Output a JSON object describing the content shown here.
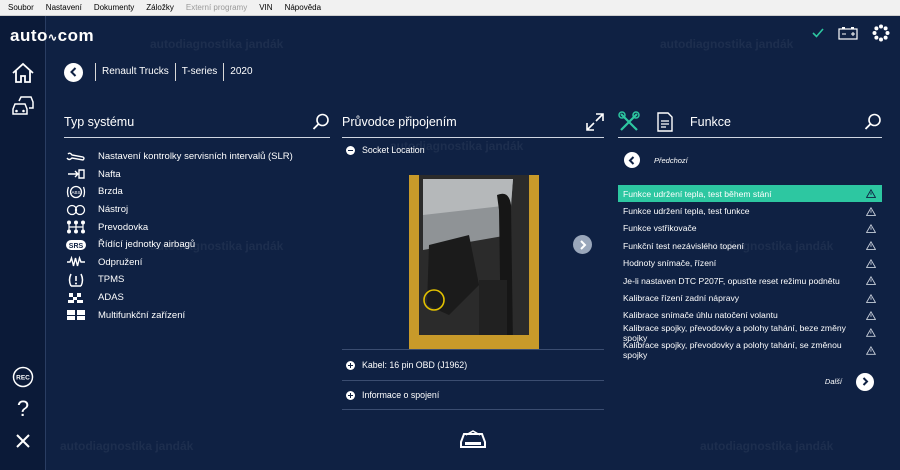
{
  "menu": [
    "Soubor",
    "Nastavení",
    "Dokumenty",
    "Záložky",
    "Externí programy",
    "VIN",
    "Nápověda"
  ],
  "logo": {
    "part1": "auto",
    "part2": "com"
  },
  "status": {
    "check_color": "#2dc7a1"
  },
  "breadcrumb": [
    "Renault Trucks",
    "T-series",
    "2020"
  ],
  "systems": {
    "title": "Typ systému",
    "items": [
      {
        "label": "Nastavení kontrolky servisních intervalů (SLR)",
        "icon": "wrench-icon"
      },
      {
        "label": "Nafta",
        "icon": "fuel-icon"
      },
      {
        "label": "Brzda",
        "icon": "abs-icon"
      },
      {
        "label": "Nástroj",
        "icon": "dashboard-icon"
      },
      {
        "label": "Prevodovka",
        "icon": "gearbox-icon"
      },
      {
        "label": "Řídící jednotky airbagů",
        "icon": "srs-icon"
      },
      {
        "label": "Odpružení",
        "icon": "suspension-icon"
      },
      {
        "label": "TPMS",
        "icon": "tpms-icon"
      },
      {
        "label": "ADAS",
        "icon": "adas-icon"
      },
      {
        "label": "Multifunkční zařízení",
        "icon": "multifunction-icon"
      }
    ]
  },
  "guide": {
    "title": "Průvodce připojením",
    "socket": "Socket Location",
    "cable": "Kabel: 16 pin OBD (J1962)",
    "info": "Informace o spojení"
  },
  "functions": {
    "title": "Funkce",
    "prev": "Předchozí",
    "next": "Další",
    "accent": "#2dc7a1",
    "items": [
      "Funkce udržení tepla, test během stání",
      "Funkce udržení tepla, test funkce",
      "Funkce vstřikovače",
      "Funkční test nezávislého topení",
      "Hodnoty snímače, řízení",
      "Je-li nastaven DTC P207F, opusťte reset režimu podnětu",
      "Kalibrace řízení zadní nápravy",
      "Kalibrace snímače úhlu natočení volantu",
      "Kalibrace spojky, převodovky a polohy tahání, beze změny spojky",
      "Kalibrace spojky, převodovky a polohy tahání, se změnou spojky"
    ],
    "selected": 0
  },
  "watermark": "autodiagnostika jandák"
}
